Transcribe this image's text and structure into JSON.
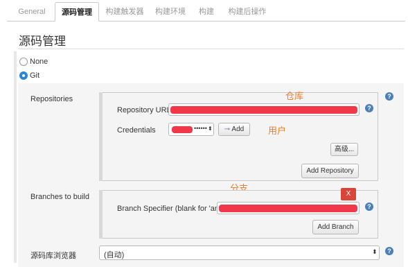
{
  "tabs": [
    {
      "label": "General",
      "active": false
    },
    {
      "label": "源码管理",
      "active": true
    },
    {
      "label": "构建触发器",
      "active": false
    },
    {
      "label": "构建环境",
      "active": false
    },
    {
      "label": "构建",
      "active": false
    },
    {
      "label": "构建后操作",
      "active": false
    }
  ],
  "section": {
    "title": "源码管理"
  },
  "scm_options": {
    "none_label": "None",
    "git_label": "Git",
    "selected": "Git"
  },
  "repositories": {
    "label": "Repositories",
    "url_label": "Repository URL",
    "credentials_label": "Credentials",
    "credentials_value": "••••••",
    "add_label": "Add",
    "advanced_label": "高级...",
    "add_repository_label": "Add Repository"
  },
  "branches": {
    "label": "Branches to build",
    "specifier_label": "Branch Specifier (blank for 'any')",
    "delete_label": "X",
    "add_branch_label": "Add Branch"
  },
  "browser": {
    "label": "源码库浏览器",
    "value": "(自动)"
  },
  "annotations": {
    "repo": "仓库",
    "user": "用户",
    "branch": "分支"
  },
  "help": "?",
  "colors": {
    "accent": "#2b86d9",
    "redaction": "#f0384a",
    "annotation": "#f07b2a",
    "delete_button": "#d9443b"
  }
}
